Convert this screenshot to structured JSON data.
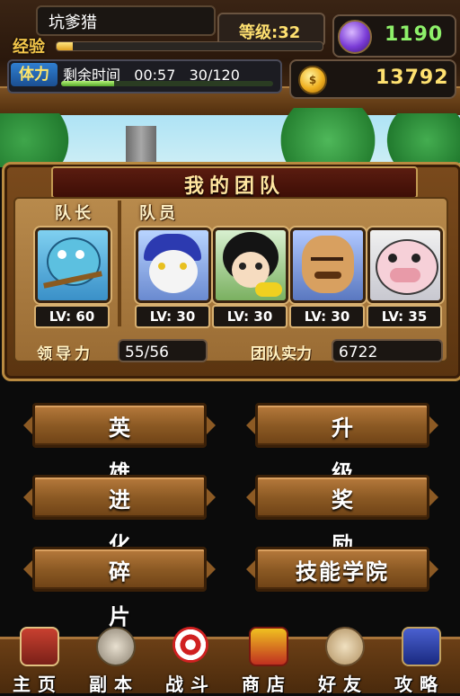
{
  "player": {
    "name": "坑爹猎",
    "level_label": "等级:32",
    "exp_label": "经验",
    "exp_progress": 0.06,
    "gems": "1190",
    "coins": "13792",
    "coin_symbol": "$"
  },
  "stamina": {
    "label": "体力",
    "text": "剩余时间   00:57   30/120",
    "progress": 0.25
  },
  "team": {
    "title": "我的团队",
    "captain_label": "队长",
    "members_label": "队员",
    "captain": {
      "name": "captain",
      "level": "LV: 60"
    },
    "members": [
      {
        "name": "member-1",
        "level": "LV: 30"
      },
      {
        "name": "member-2",
        "level": "LV: 30"
      },
      {
        "name": "member-3",
        "level": "LV: 30"
      },
      {
        "name": "member-4",
        "level": "LV: 35"
      }
    ],
    "leadership_label": "领导力",
    "leadership_value": "55/56",
    "power_label": "团队实力",
    "power_value": "6722"
  },
  "menu": {
    "heroes": "英雄",
    "upgrade": "升级",
    "evolve": "进化",
    "rewards": "奖励",
    "fragments": "碎片",
    "skill_academy": "技能学院"
  },
  "nav": [
    {
      "label": "主页",
      "icon": "home-icon"
    },
    {
      "label": "副本",
      "icon": "skull-icon"
    },
    {
      "label": "战斗",
      "icon": "target-icon"
    },
    {
      "label": "商店",
      "icon": "shop-icon"
    },
    {
      "label": "好友",
      "icon": "friends-icon"
    },
    {
      "label": "攻略",
      "icon": "guide-icon"
    }
  ],
  "colors": {
    "accent_gold": "#ffe170",
    "gem_green": "#8ef06a",
    "wood": "#8c5a24"
  }
}
